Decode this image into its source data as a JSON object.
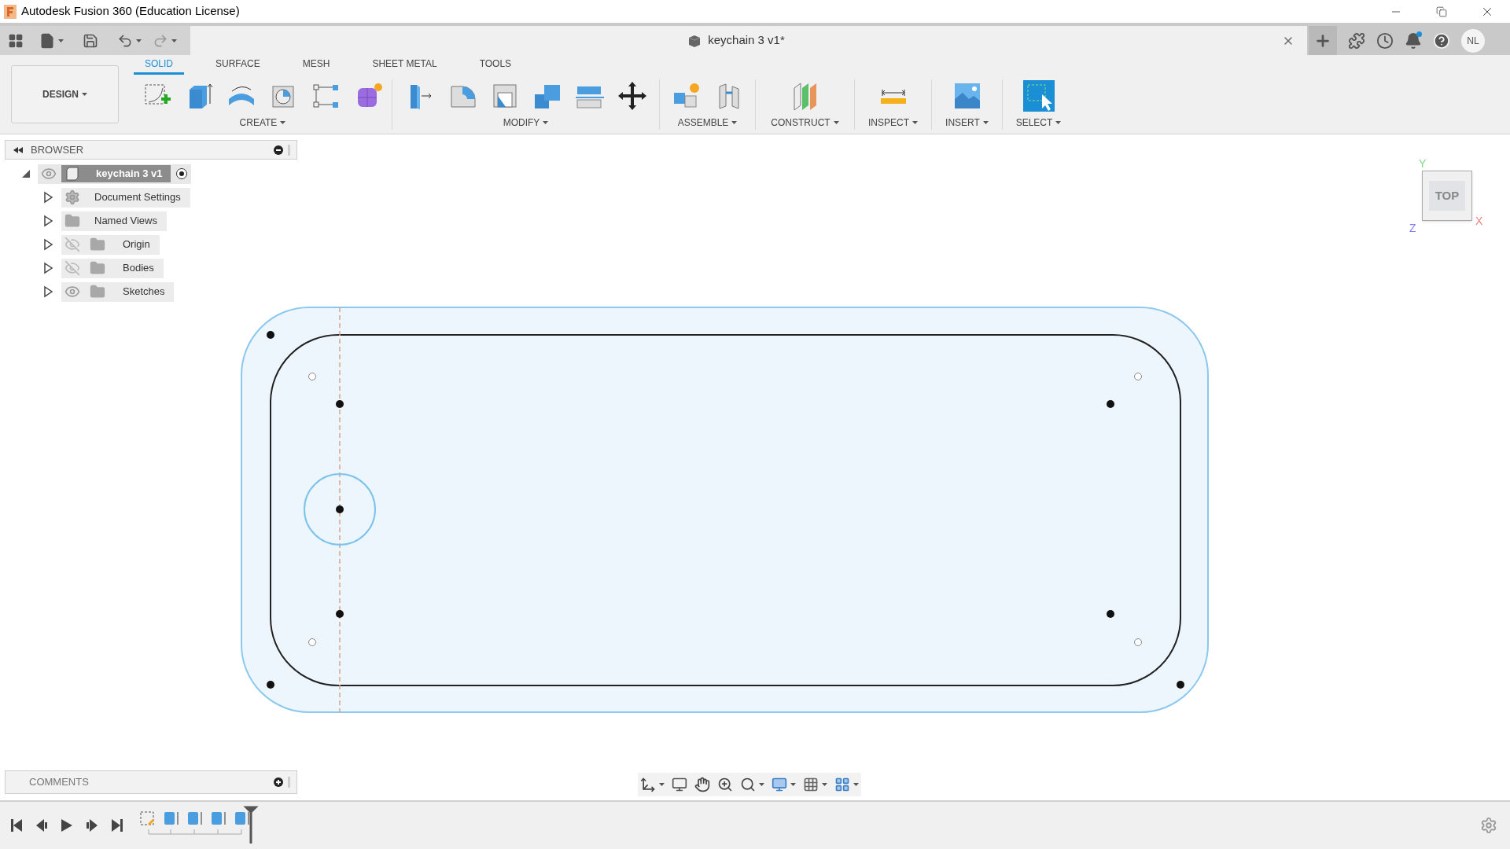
{
  "window": {
    "title": "Autodesk Fusion 360 (Education License)"
  },
  "document_tab": {
    "title": "keychain 3 v1*"
  },
  "user": {
    "initials": "NL"
  },
  "workspace": {
    "label": "DESIGN"
  },
  "ribbon_tabs": [
    {
      "label": "SOLID",
      "selected": true
    },
    {
      "label": "SURFACE",
      "selected": false
    },
    {
      "label": "MESH",
      "selected": false
    },
    {
      "label": "SHEET METAL",
      "selected": false
    },
    {
      "label": "TOOLS",
      "selected": false
    }
  ],
  "tool_groups": [
    {
      "label": "CREATE"
    },
    {
      "label": "MODIFY"
    },
    {
      "label": "ASSEMBLE"
    },
    {
      "label": "CONSTRUCT"
    },
    {
      "label": "INSPECT"
    },
    {
      "label": "INSERT"
    },
    {
      "label": "SELECT"
    }
  ],
  "browser": {
    "title": "BROWSER",
    "root": {
      "name": "keychain 3 v1",
      "expanded": true,
      "visible": true,
      "children": [
        {
          "name": "Document Settings",
          "kind": "settings",
          "expanded": false
        },
        {
          "name": "Named Views",
          "kind": "folder",
          "expanded": false
        },
        {
          "name": "Origin",
          "kind": "layer",
          "visible": false,
          "expanded": false
        },
        {
          "name": "Bodies",
          "kind": "layer",
          "visible": false,
          "expanded": false
        },
        {
          "name": "Sketches",
          "kind": "layer",
          "visible": true,
          "expanded": false
        }
      ]
    }
  },
  "comments": {
    "title": "COMMENTS"
  },
  "view_cube": {
    "face": "TOP",
    "axes": [
      {
        "label": "Y",
        "color": "#7ddc7d"
      },
      {
        "label": "X",
        "color": "#f08080"
      },
      {
        "label": "Z",
        "color": "#7f7ff0"
      }
    ]
  }
}
